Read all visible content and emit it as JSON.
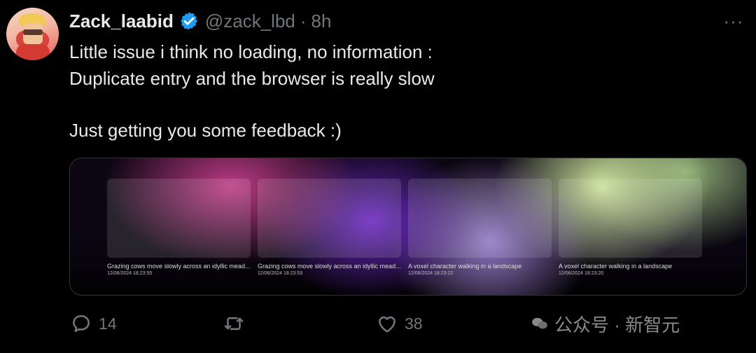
{
  "tweet": {
    "author_name": "Zack_laabid",
    "handle": "@zack_lbd",
    "separator": "·",
    "time": "8h",
    "more": "···",
    "lines": [
      "Little issue i think no loading, no information :",
      "Duplicate entry and the browser is really slow",
      "",
      "Just getting you some feedback :)"
    ]
  },
  "media": {
    "cards": [
      {
        "caption": "Grazing cows move slowly across an idyllic mead...",
        "date": "12/06/2024 18:23:55"
      },
      {
        "caption": "Grazing cows move slowly across an idyllic mead...",
        "date": "12/06/2024 18:23:53"
      },
      {
        "caption": "A voxel character walking in a landscape",
        "date": "12/06/2024 18:23:22"
      },
      {
        "caption": "A voxel character walking in a landscape",
        "date": "12/06/2024 18:23:20"
      }
    ]
  },
  "actions": {
    "reply_count": "14",
    "repost_count": "",
    "like_count": "38"
  },
  "watermark": {
    "text": "公众号 · 新智元"
  },
  "icons": {
    "verified": "verified-badge-icon",
    "reply": "reply-icon",
    "repost": "repost-icon",
    "like": "heart-icon",
    "watermark": "wechat-icon"
  },
  "colors": {
    "background": "#000000",
    "text_primary": "#e7e9ea",
    "text_secondary": "#71767b",
    "verified": "#1d9bf0"
  }
}
